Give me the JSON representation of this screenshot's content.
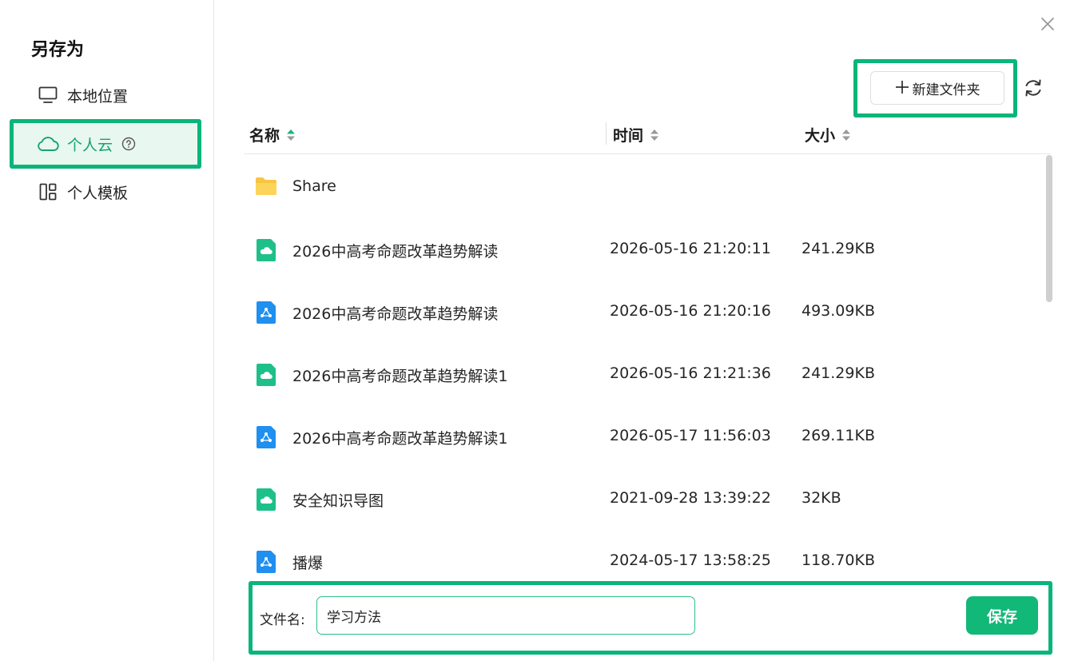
{
  "dialog": {
    "title": "另存为",
    "close_icon": "close-icon"
  },
  "sidebar": {
    "items": [
      {
        "label": "本地位置",
        "icon": "monitor-icon"
      },
      {
        "label": "个人云",
        "icon": "cloud-icon",
        "active": true
      },
      {
        "label": "个人模板",
        "icon": "template-icon"
      }
    ]
  },
  "toolbar": {
    "new_folder_label": "新建文件夹",
    "refresh_icon": "refresh-icon"
  },
  "table": {
    "headers": {
      "name": "名称",
      "time": "时间",
      "size": "大小"
    },
    "rows": [
      {
        "type": "folder",
        "name": "Share",
        "time": "",
        "size": ""
      },
      {
        "type": "cloud-doc",
        "name": "2026中高考命题改革趋势解读",
        "time": "2026-05-16 21:20:11",
        "size": "241.29KB"
      },
      {
        "type": "mindmap-doc",
        "name": "2026中高考命题改革趋势解读",
        "time": "2026-05-16 21:20:16",
        "size": "493.09KB"
      },
      {
        "type": "cloud-doc",
        "name": "2026中高考命题改革趋势解读1",
        "time": "2026-05-16 21:21:36",
        "size": "241.29KB"
      },
      {
        "type": "mindmap-doc",
        "name": "2026中高考命题改革趋势解读1",
        "time": "2026-05-17 11:56:03",
        "size": "269.11KB"
      },
      {
        "type": "cloud-doc",
        "name": "安全知识导图",
        "time": "2021-09-28 13:39:22",
        "size": "32KB"
      },
      {
        "type": "mindmap-doc",
        "name": "播爆",
        "time": "2024-05-17 13:58:25",
        "size": "118.70KB"
      }
    ]
  },
  "footer": {
    "filename_label": "文件名:",
    "filename_value": "学习方法",
    "save_label": "保存"
  },
  "colors": {
    "accent": "#12b877",
    "highlight": "#0ab57a",
    "folder": "#f7c542",
    "cloud_doc": "#1ec08a",
    "mindmap_doc": "#1f8ff0"
  }
}
